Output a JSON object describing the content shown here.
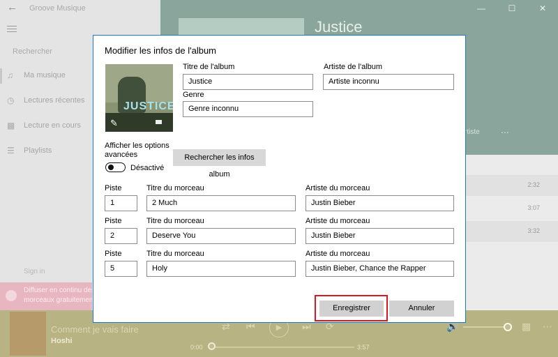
{
  "app": {
    "title": "Groove Musique",
    "search_placeholder": "Rechercher",
    "nav": [
      {
        "label": "Ma musique",
        "icon": "music-note-icon"
      },
      {
        "label": "Lectures récentes",
        "icon": "clock-icon"
      },
      {
        "label": "Lecture en cours",
        "icon": "equalizer-icon"
      },
      {
        "label": "Playlists",
        "icon": "playlist-icon"
      }
    ],
    "sign_in": "Sign in",
    "spotify_promo": "Diffuser en continu des morceaux gratuitement",
    "album_header": {
      "title": "Justice",
      "artist_link": "rtiste",
      "more": "..."
    },
    "track_durations": [
      "2:32",
      "3:07",
      "3:32"
    ]
  },
  "player": {
    "song": "Comment je vais faire",
    "artist": "Hoshi",
    "elapsed": "0:00",
    "total": "3:57",
    "progress": 0.0
  },
  "dialog": {
    "title": "Modifier les infos de l'album",
    "album_title_label": "Titre de l'album",
    "album_title_value": "Justice",
    "album_artist_label": "Artiste de l'album",
    "album_artist_value": "Artiste inconnu",
    "genre_label": "Genre",
    "genre_value": "Genre inconnu",
    "advanced_label": "Afficher les options avancées",
    "advanced_state": "Désactivé",
    "search_button": "Rechercher les infos album",
    "cover_logo": "JUSTICE",
    "tracks": [
      {
        "track_label": "Piste",
        "track_no": "1",
        "title_label": "Titre du morceau",
        "title": "2 Much",
        "artist_label": "Artiste du morceau",
        "artist": "Justin Bieber"
      },
      {
        "track_label": "Piste",
        "track_no": "2",
        "title_label": "Titre du morceau",
        "title": "Deserve You",
        "artist_label": "Artiste du morceau",
        "artist": "Justin Bieber"
      },
      {
        "track_label": "Piste",
        "track_no": "5",
        "title_label": "Titre du morceau",
        "title": "Holy",
        "artist_label": "Artiste du morceau",
        "artist": "Justin Bieber, Chance the Rapper"
      }
    ],
    "save_button": "Enregistrer",
    "cancel_button": "Annuler"
  }
}
